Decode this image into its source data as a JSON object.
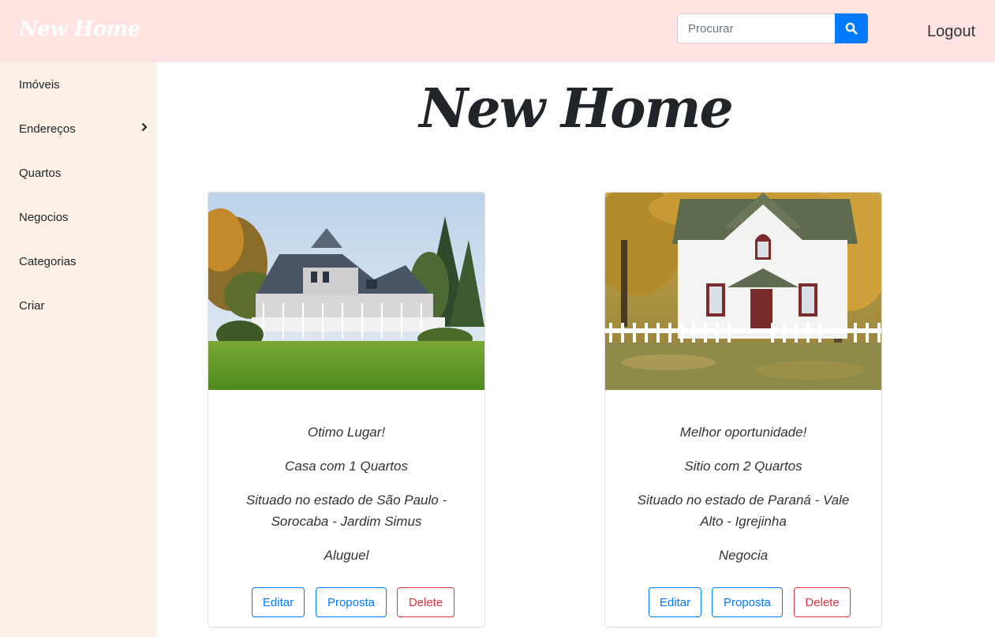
{
  "header": {
    "brand": "New Home",
    "search_placeholder": "Procurar",
    "logout_label": "Logout"
  },
  "sidebar": {
    "items": [
      {
        "label": "Imóveis"
      },
      {
        "label": "Endereços"
      },
      {
        "label": "Quartos"
      },
      {
        "label": "Negocios"
      },
      {
        "label": "Categorias"
      },
      {
        "label": "Criar"
      }
    ]
  },
  "main": {
    "title": "New Home"
  },
  "cards": [
    {
      "headline": "Otimo Lugar!",
      "rooms": "Casa com 1 Quartos",
      "location_line1": "Situado no estado de São Paulo -",
      "location_line2": "Sorocaba - Jardim Simus",
      "deal": "Aluguel",
      "edit_label": "Editar",
      "proposal_label": "Proposta",
      "delete_label": "Delete"
    },
    {
      "headline": "Melhor oportunidade!",
      "rooms": "Sitio com 2 Quartos",
      "location_line1": "Situado no estado de Paraná - Vale",
      "location_line2": "Alto - Igrejinha",
      "deal": "Negocia",
      "edit_label": "Editar",
      "proposal_label": "Proposta",
      "delete_label": "Delete"
    }
  ],
  "icons": {
    "search": "search-icon",
    "sidebar_expand": "chevron-right-icon"
  },
  "colors": {
    "navbar_bg": "#ffe4e1",
    "sidebar_bg": "#fbf0e6",
    "primary": "#007bff",
    "danger": "#dc3545"
  }
}
